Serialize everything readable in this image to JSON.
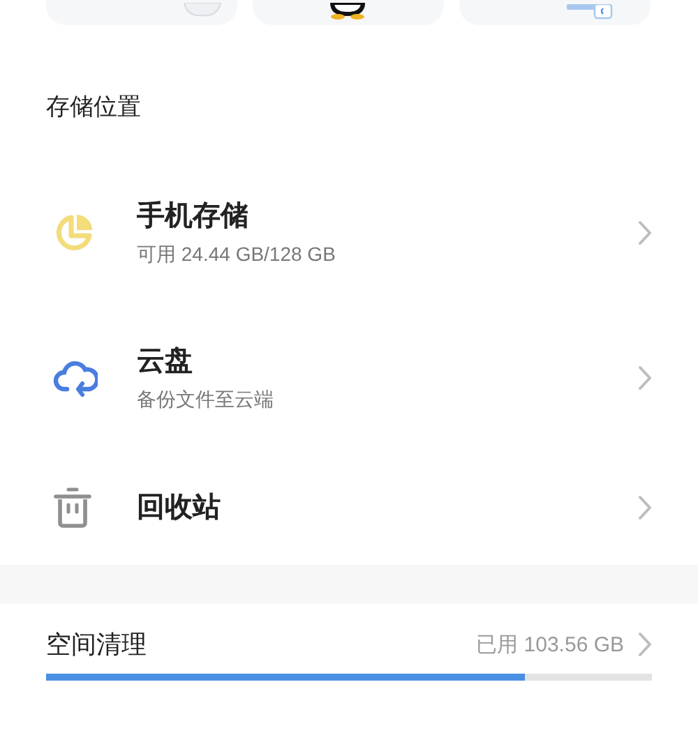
{
  "shortcuts": [
    {
      "kind": "cloud"
    },
    {
      "kind": "mascot"
    },
    {
      "kind": "document"
    }
  ],
  "section": {
    "title": "存储位置"
  },
  "items": [
    {
      "kind": "pie",
      "title": "手机存储",
      "subtitle": "可用 24.44 GB/128 GB"
    },
    {
      "kind": "cloud",
      "title": "云盘",
      "subtitle": "备份文件至云端"
    },
    {
      "kind": "trash",
      "title": "回收站"
    }
  ],
  "cleanup": {
    "title": "空间清理",
    "reading": "已用 103.56 GB",
    "level": 0.79
  }
}
